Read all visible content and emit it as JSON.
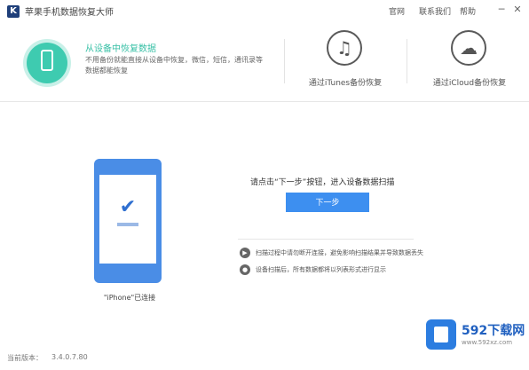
{
  "app": {
    "icon_letter": "K",
    "title": "苹果手机数据恢复大师"
  },
  "top_menu": [
    "官网",
    "联系我们",
    "帮助"
  ],
  "window_buttons": {
    "minimize": "─",
    "close": "✕"
  },
  "modes": {
    "device": {
      "title": "从设备中恢复数据",
      "desc": "不用备份就能直接从设备中恢复，微信，短信，通讯录等数据都能恢复"
    },
    "itunes": {
      "label": "通过iTunes备份恢复",
      "icon": "music-note-icon",
      "glyph": "♫"
    },
    "icloud": {
      "label": "通过iCloud备份恢复",
      "icon": "cloud-icon",
      "glyph": "☁"
    }
  },
  "main": {
    "phone_status": "\"iPhone\"已连接",
    "prompt": "请点击“下一步”按钮，进入设备数据扫描",
    "next_button": "下一步",
    "tips": [
      {
        "icon": "info-icon",
        "text": "扫描过程中请勿断开连接，避免影响扫描结果并导致数据丢失"
      },
      {
        "icon": "warning-icon",
        "text": "设备扫描后，所有数据都将以列表形式进行显示"
      }
    ]
  },
  "footer": {
    "version_label": "当前版本：",
    "version": "3.4.0.7.80"
  },
  "watermark": {
    "text": "592下载网",
    "sub": "www.592xz.com"
  },
  "colors": {
    "accent": "#3d8ff0",
    "green": "#3ecbb0",
    "phone_blue": "#4a8de6"
  }
}
